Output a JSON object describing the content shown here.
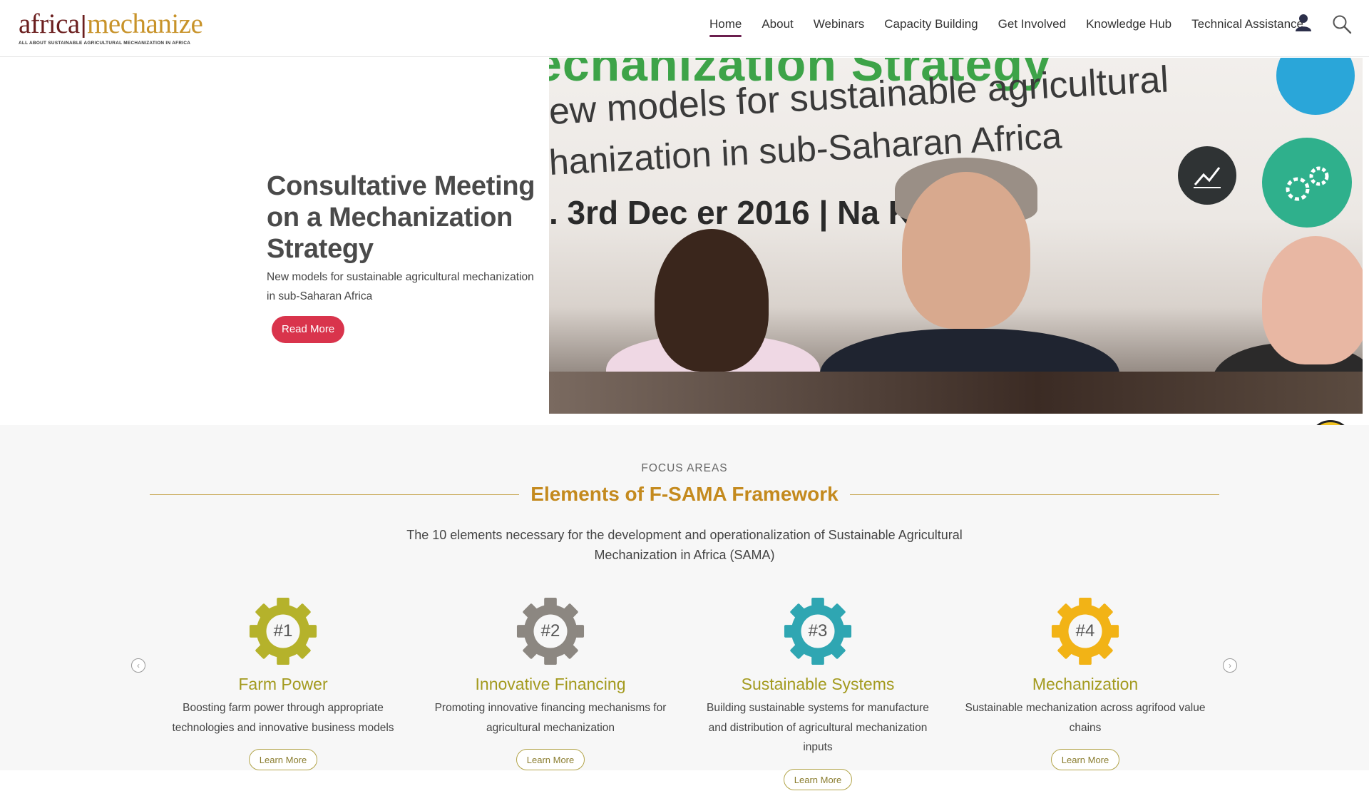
{
  "logo": {
    "part1": "africa",
    "separator": "|",
    "part2": "mechanize",
    "tagline": "ALL ABOUT SUSTAINABLE AGRICULTURAL MECHANIZATION IN AFRICA"
  },
  "nav": {
    "items": [
      {
        "label": "Home",
        "active": true
      },
      {
        "label": "About"
      },
      {
        "label": "Webinars"
      },
      {
        "label": "Capacity Building"
      },
      {
        "label": "Get Involved"
      },
      {
        "label": "Knowledge Hub"
      },
      {
        "label": "Technical Assistance"
      }
    ],
    "user_icon": "user-icon",
    "search_icon": "search-icon"
  },
  "hero": {
    "title": "Consultative Meeting on a Mechanization Strategy",
    "subtitle": "New models for sustainable agricultural mechanization in sub-Saharan Africa",
    "button_label": "Read More",
    "banner": {
      "line1": "echanization Strategy",
      "line2": "ew models for sustainable agricultural",
      "line3": "hanization in sub-Saharan Africa",
      "line4": ". 3rd Dec    er 2016 | Na      Kenya"
    }
  },
  "accessibility_icon": "wheelchair-icon",
  "focus": {
    "eyebrow": "FOCUS AREAS",
    "title": "Elements of F-SAMA Framework",
    "description": "The 10 elements necessary for the development and operationalization of Sustainable Agricultural Mechanization in Africa (SAMA)",
    "prev_icon": "chevron-left-icon",
    "next_icon": "chevron-right-icon",
    "cards": [
      {
        "number": "#1",
        "title": "Farm Power",
        "description": "Boosting farm power through appropriate technologies and innovative business models",
        "button": "Learn More",
        "color": "#b5b22b"
      },
      {
        "number": "#2",
        "title": "Innovative Financing",
        "description": "Promoting innovative financing mechanisms for agricultural mechanization",
        "button": "Learn More",
        "color": "#8c8781"
      },
      {
        "number": "#3",
        "title": "Sustainable Systems",
        "description": "Building sustainable systems for manufacture and distribution of agricultural mechanization inputs",
        "button": "Learn More",
        "color": "#2fa6b2"
      },
      {
        "number": "#4",
        "title": "Mechanization",
        "description": "Sustainable mechanization across agrifood value chains",
        "button": "Learn More",
        "color": "#f2b316"
      }
    ]
  },
  "colors": {
    "accent_red": "#d9344c",
    "gold": "#c48a1e",
    "brand_dark": "#6b1e1e"
  }
}
